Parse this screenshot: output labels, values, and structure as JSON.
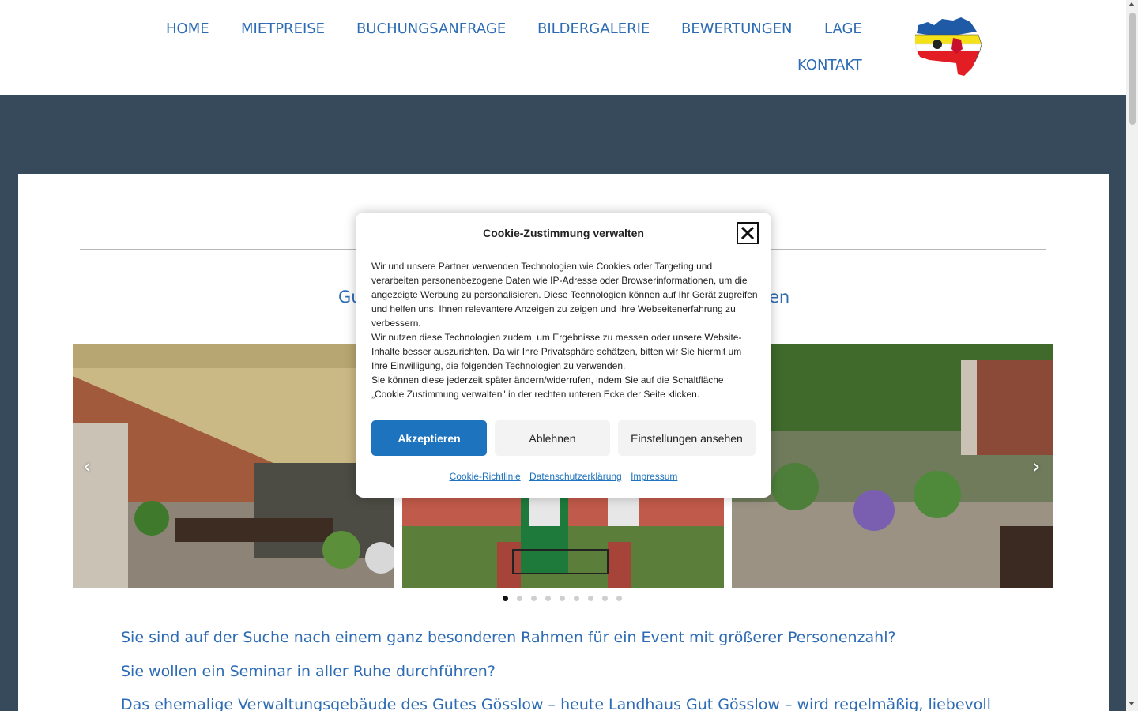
{
  "nav": {
    "items": [
      {
        "label": "HOME"
      },
      {
        "label": "MIETPREISE"
      },
      {
        "label": "BUCHUNGSANFRAGE"
      },
      {
        "label": "BILDERGALERIE"
      },
      {
        "label": "BEWERTUNGEN"
      },
      {
        "label": "LAGE"
      },
      {
        "label": "KONTAKT"
      }
    ],
    "logo_icon": "mecklenburg-vorpommern-map-icon"
  },
  "main": {
    "subtitle_left": "Gu",
    "subtitle_right": "en",
    "carousel": {
      "prev_icon": "chevron-left-icon",
      "next_icon": "chevron-right-icon",
      "prev_glyph": "‹",
      "next_glyph": "›",
      "slides": [
        {
          "icon": "terrace-awning-photo"
        },
        {
          "icon": "manor-house-photo"
        },
        {
          "icon": "garden-pond-photo"
        }
      ],
      "dot_count": 9,
      "active_dot": 1
    },
    "paragraphs": [
      "Sie sind auf der Suche nach einem ganz besonderen Rahmen für ein Event mit größerer Personenzahl?",
      "Sie wollen ein Seminar in aller Ruhe durchführen?",
      "Das ehemalige Verwaltungsgebäude des Gutes Gösslow – heute Landhaus Gut Gösslow – wird regelmäßig, liebevoll"
    ]
  },
  "cookie": {
    "title": "Cookie-Zustimmung verwalten",
    "close_icon": "close-icon",
    "text": [
      "Wir und unsere Partner verwenden Technologien wie Cookies oder Targeting und verarbeiten personenbezogene Daten wie IP-Adresse oder Browserinformationen, um die angezeigte Werbung zu personalisieren. Diese Technologien können auf Ihr Gerät zugreifen und helfen uns, Ihnen relevantere Anzeigen zu zeigen und Ihre Webseitenerfahrung zu verbessern.",
      "Wir nutzen diese Technologien zudem, um Ergebnisse zu messen oder unsere Website-Inhalte besser auszurichten. Da wir Ihre Privatsphäre schätzen, bitten wir Sie hiermit um Ihre Einwilligung, die folgenden Technologien zu verwenden.",
      "Sie können diese jederzeit später ändern/widerrufen, indem Sie auf die Schaltfläche „Cookie Zustimmung verwalten\" in der rechten unteren Ecke der Seite klicken."
    ],
    "buttons": {
      "accept": "Akzeptieren",
      "deny": "Ablehnen",
      "settings": "Einstellungen ansehen"
    },
    "links": [
      "Cookie-Richtlinie",
      "Datenschutzerklärung",
      "Impressum"
    ],
    "accent_color": "#1e73be"
  },
  "colors": {
    "nav_link": "#2d6cb5",
    "band": "#374a5c"
  }
}
